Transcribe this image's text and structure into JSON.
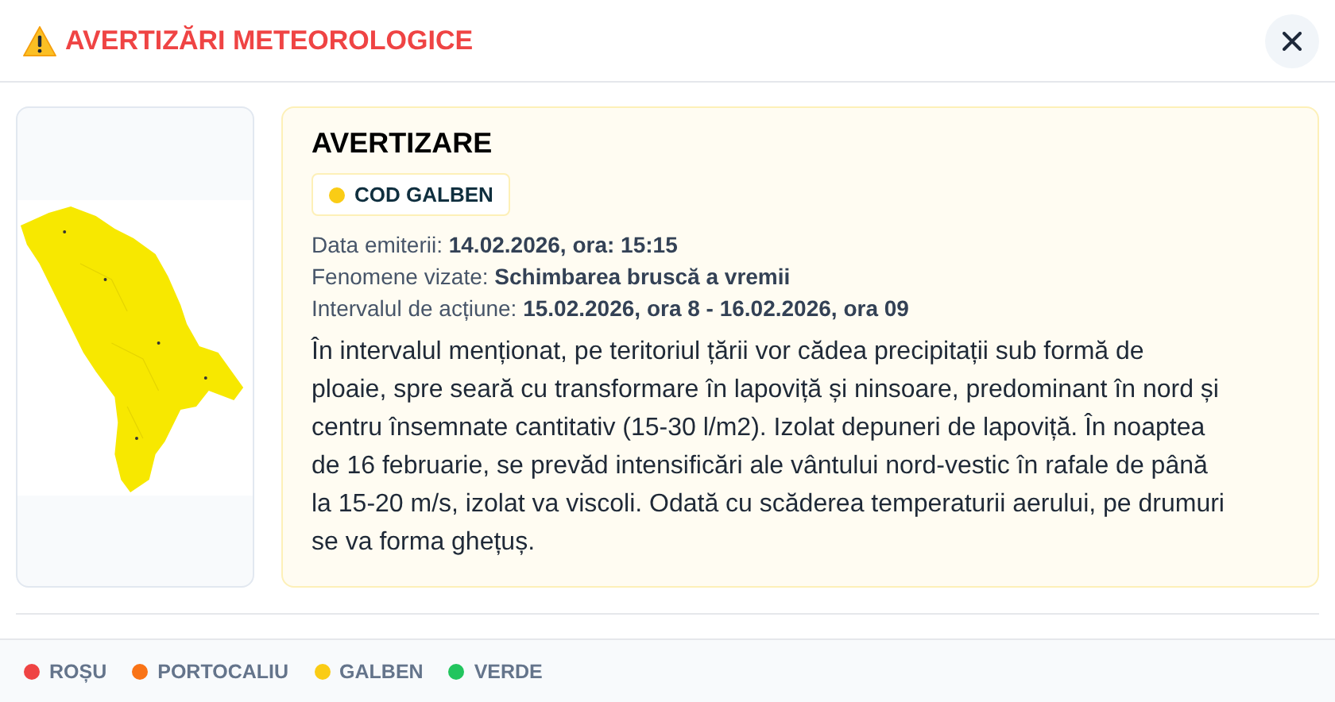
{
  "header": {
    "title": "AVERTIZĂRI METEOROLOGICE"
  },
  "warning": {
    "title": "AVERTIZARE",
    "badge": {
      "label": "COD GALBEN",
      "color": "#facc15"
    },
    "details": [
      {
        "label": "Data emiterii:",
        "value": "14.02.2026, ora: 15:15"
      },
      {
        "label": "Fenomene vizate:",
        "value": "Schimbarea bruscă a vremii"
      },
      {
        "label": "Intervalul de acțiune:",
        "value": "15.02.2026, ora 8 - 16.02.2026, ora 09"
      }
    ],
    "description": "În intervalul menționat, pe teritoriul țării vor cădea precipitații sub formă de ploaie, spre seară cu transformare în lapoviță și ninsoare, predominant în nord și centru însemnate cantitativ (15-30 l/m2). Izolat depuneri de lapoviță. În noaptea de 16 februarie, se prevăd intensificări ale vântului nord-vestic în rafale de până la 15-20 m/s, izolat va viscoli. Odată cu scăderea temperaturii aerului, pe drumuri se va forma ghețuș."
  },
  "legend": [
    {
      "label": "ROȘU",
      "color": "#ef4444"
    },
    {
      "label": "PORTOCALIU",
      "color": "#f97316"
    },
    {
      "label": "GALBEN",
      "color": "#facc15"
    },
    {
      "label": "VERDE",
      "color": "#22c55e"
    }
  ]
}
